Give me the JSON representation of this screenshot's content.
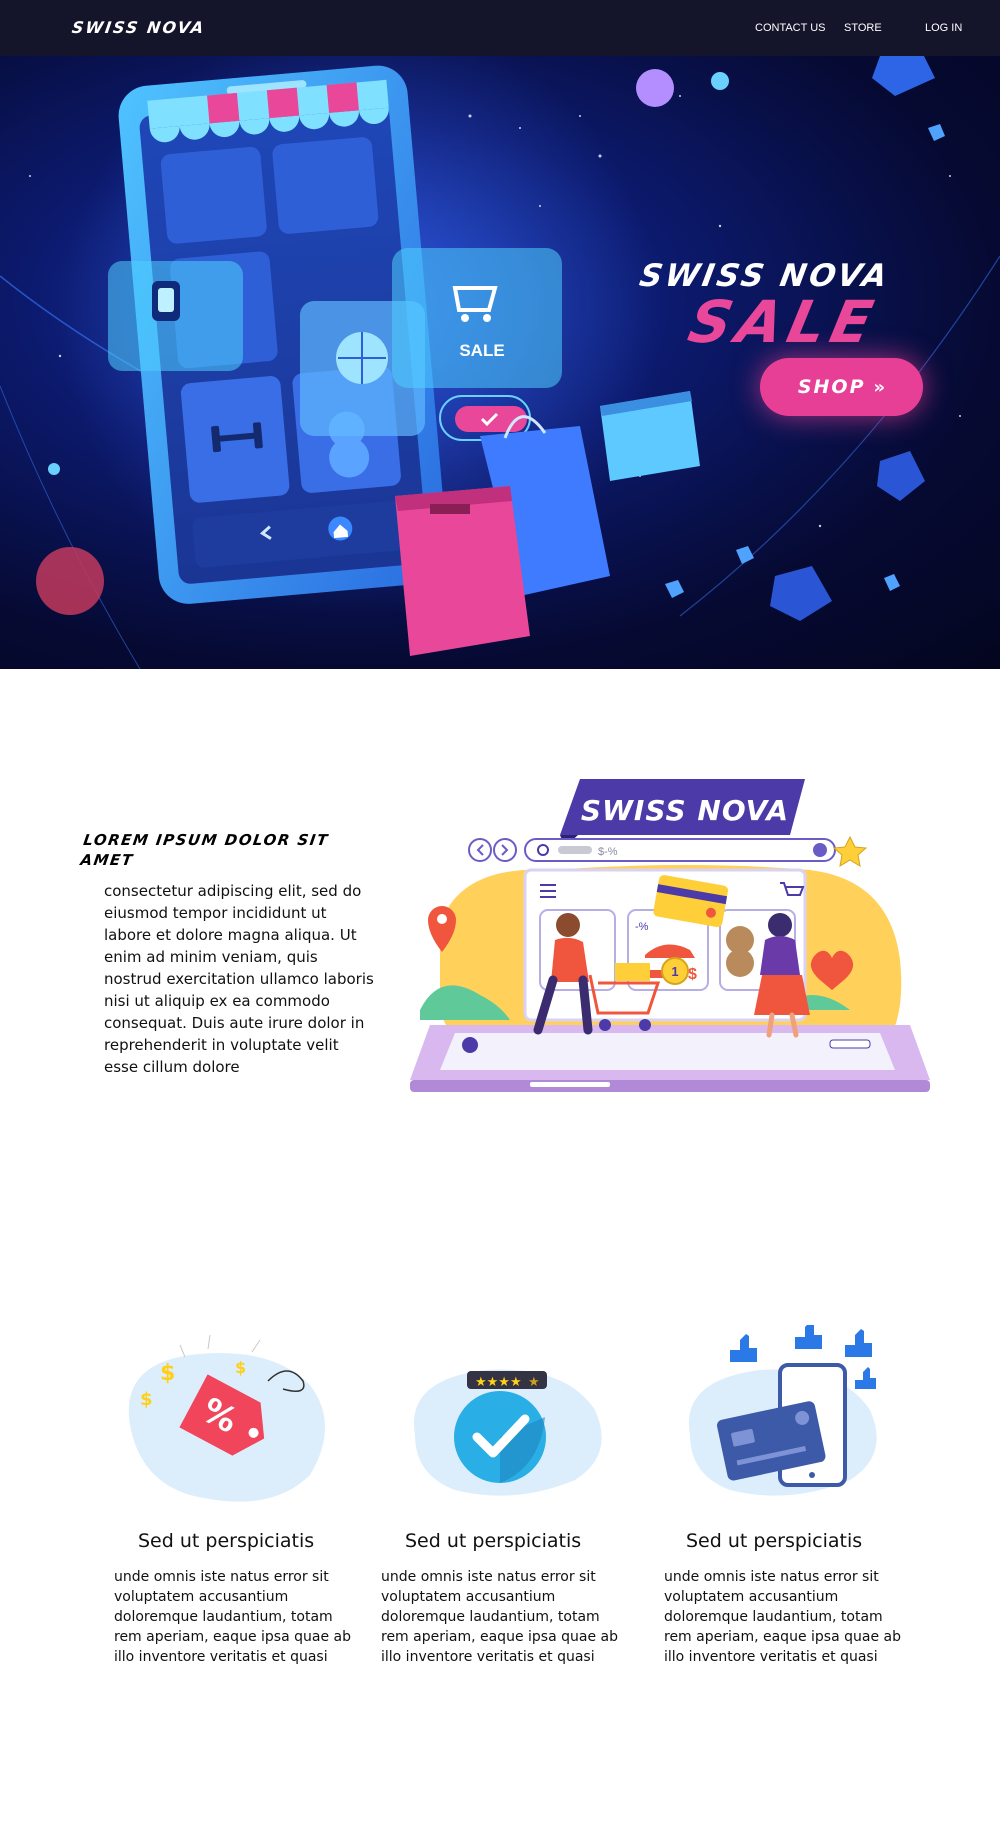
{
  "nav": {
    "logo": "SWISS NOVA",
    "links": [
      "CONTACT US",
      "STORE",
      "LOG IN"
    ]
  },
  "hero": {
    "brand": "SWISS NOVA",
    "headline": "SALE",
    "phone_sale_label": "SALE",
    "shop_button": "SHOP",
    "shop_arrows": "»"
  },
  "about": {
    "heading": "LOREM IPSUM DOLOR SIT AMET",
    "body": "consectetur adipiscing elit, sed do eiusmod tempor incididunt ut labore et dolore magna aliqua. Ut enim ad minim veniam, quis nostrud exercitation ullamco laboris nisi ut aliquip ex ea commodo consequat. Duis aute irure dolor in reprehenderit in voluptate velit esse cillum dolore",
    "banner": "SWISS NOVA",
    "search_text": "$-%",
    "badge_number": "1",
    "discount_label": "-%",
    "price_symbol": "$"
  },
  "features": [
    {
      "icon": "price-tag-icon",
      "tag_text": "%",
      "title": "Sed ut perspiciatis",
      "text": "unde omnis iste natus error sit voluptatem accusantium doloremque laudantium, totam rem aperiam, eaque ipsa quae ab illo inventore veritatis et quasi"
    },
    {
      "icon": "checkmark-rating-icon",
      "rating": 4.5,
      "title": "Sed ut perspiciatis",
      "text": "unde omnis iste natus error sit voluptatem accusantium doloremque laudantium, totam rem aperiam, eaque ipsa quae ab illo inventore veritatis et quasi"
    },
    {
      "icon": "card-payment-icon",
      "title": "Sed ut perspiciatis",
      "text": "unde omnis iste natus error sit voluptatem accusantium doloremque laudantium, totam rem aperiam, eaque ipsa quae ab illo inventore veritatis et quasi"
    }
  ],
  "colors": {
    "nav_bg": "#14142a",
    "hero_bg": "#0c1a6e",
    "accent_pink": "#e83f96",
    "accent_cyan": "#4fd0ff",
    "purple": "#4b3aa8"
  }
}
